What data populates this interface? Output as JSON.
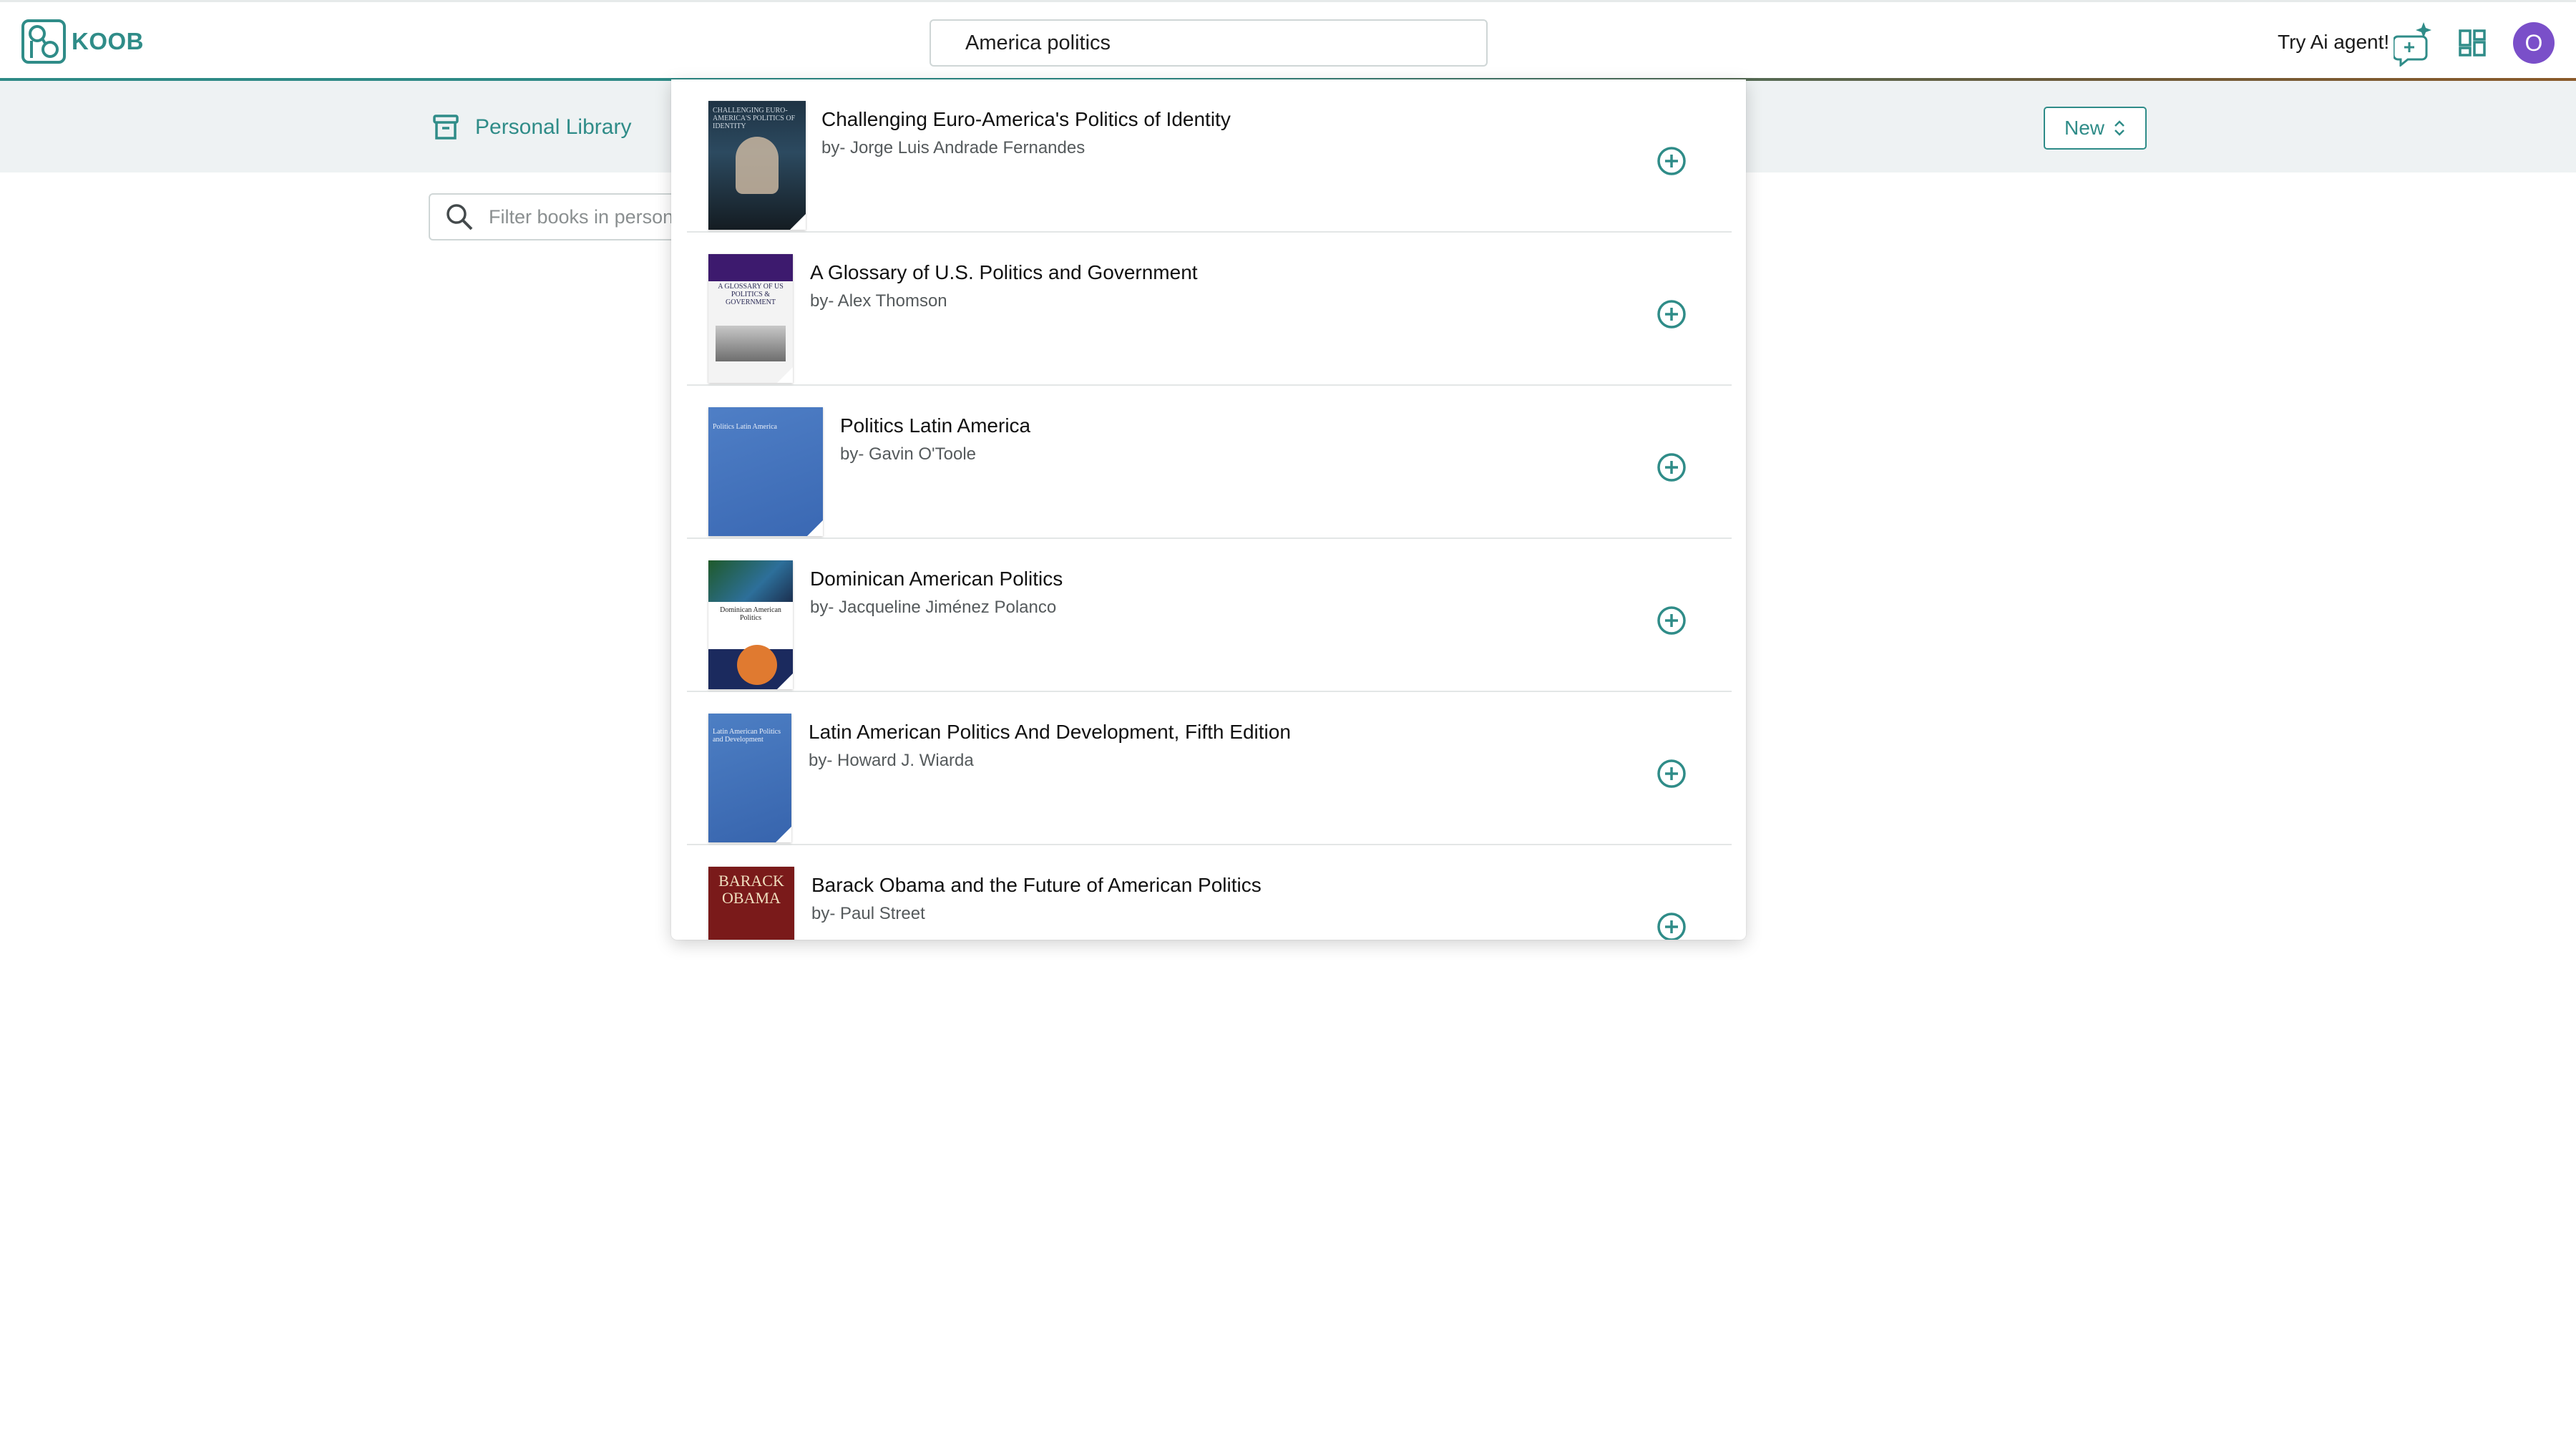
{
  "app": {
    "logo_text": "KOOB"
  },
  "header": {
    "search_value": "America politics",
    "try_ai_label": "Try Ai agent!",
    "avatar_initial": "O"
  },
  "subheader": {
    "library_label": "Personal Library",
    "new_button_label": "New",
    "filter_placeholder": "Filter books in personal library"
  },
  "colors": {
    "accent": "#2f8c88",
    "avatar": "#7a4fc9",
    "subheader_bg": "#eef2f3"
  },
  "icons": {
    "logo": "koob-logo-icon",
    "ai": "ai-chat-sparkle-icon",
    "apps": "apps-grid-icon",
    "library": "archive-box-icon",
    "sort": "chevron-up-down-icon",
    "search": "search-icon",
    "add": "plus-circle-icon"
  },
  "results": [
    {
      "title": "Challenging Euro-America's Politics of Identity",
      "author": "by- Jorge Luis Andrade Fernandes",
      "cover_text": "CHALLENGING EURO-AMERICA'S POLITICS OF IDENTITY"
    },
    {
      "title": "A Glossary of U.S. Politics and Government",
      "author": "by- Alex Thomson",
      "cover_text": "A GLOSSARY OF US POLITICS & GOVERNMENT"
    },
    {
      "title": "Politics Latin America",
      "author": "by- Gavin O'Toole",
      "cover_text": "Politics Latin America"
    },
    {
      "title": "Dominican American Politics",
      "author": "by- Jacqueline Jiménez Polanco",
      "cover_text": "Dominican American Politics"
    },
    {
      "title": "Latin American Politics And Development, Fifth Edition",
      "author": "by- Howard J. Wiarda",
      "cover_text": "Latin American Politics and Development"
    },
    {
      "title": "Barack Obama and the Future of American Politics",
      "author": "by- Paul Street",
      "cover_text": "BARACK OBAMA"
    }
  ]
}
